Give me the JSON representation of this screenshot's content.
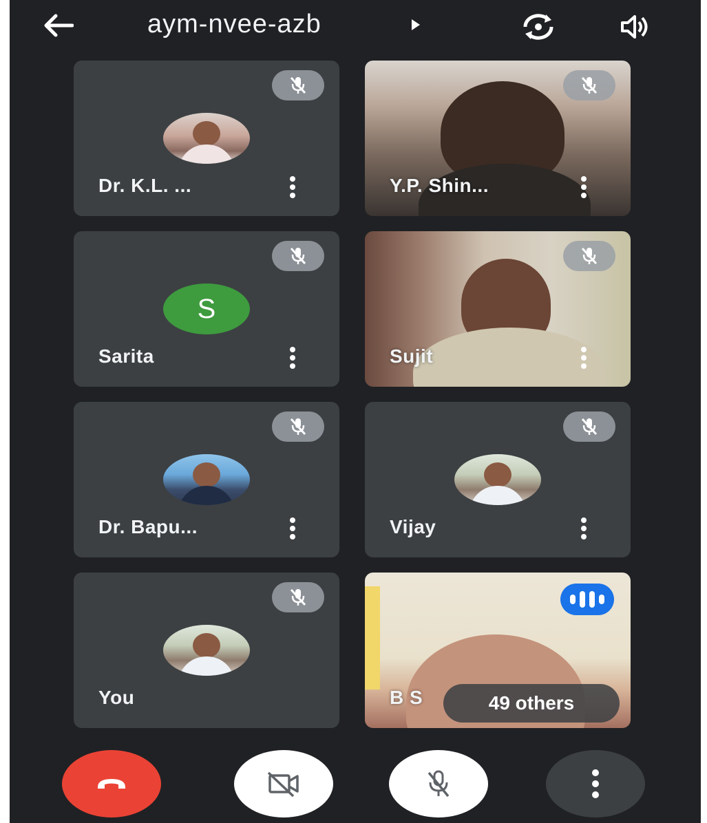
{
  "meeting": {
    "code": "aym-nvee-azb"
  },
  "topbar": {
    "back_icon": "arrow-left-icon",
    "caret_icon": "caret-right-icon",
    "rotate_icon": "camera-switch-icon",
    "speaker_icon": "speaker-icon"
  },
  "participants": [
    {
      "name": "Dr. K.L. ...",
      "avatar": "photo",
      "muted": true
    },
    {
      "name": "Y.P. Shin...",
      "avatar": "video",
      "muted": true
    },
    {
      "name": "Sarita",
      "avatar_letter": "S",
      "muted": true
    },
    {
      "name": "Sujit",
      "avatar": "video",
      "muted": true
    },
    {
      "name": "Dr. Bapu...",
      "avatar": "photo",
      "muted": true
    },
    {
      "name": "Vijay",
      "avatar": "photo",
      "muted": true
    },
    {
      "name": "You",
      "avatar": "photo",
      "muted": true
    },
    {
      "name": "B S",
      "avatar": "video",
      "speaking": true
    }
  ],
  "overflow": {
    "label": "49 others"
  },
  "controls": {
    "hangup_icon": "hang-up-icon",
    "camera_icon": "camera-off-icon",
    "mic_icon": "mic-off-icon",
    "more_icon": "more-vert-icon"
  },
  "colors": {
    "background": "#202124",
    "tile": "#3c4043",
    "hangup": "#ea4335",
    "speaking": "#1a73e8",
    "avatar_s": "#3e9b3e"
  }
}
